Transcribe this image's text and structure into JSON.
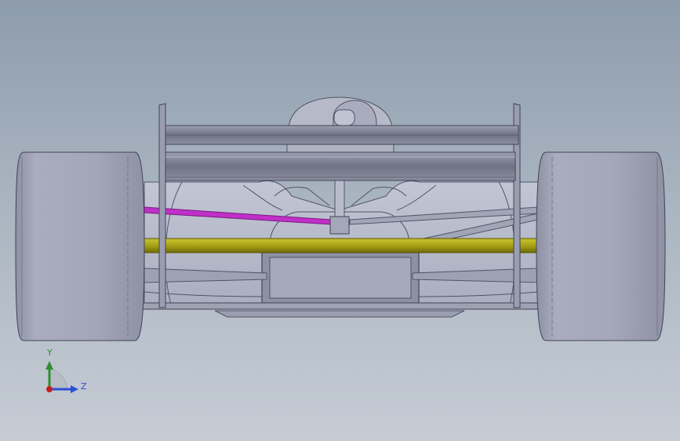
{
  "viewport": {
    "background_top": "#8d9cac",
    "background_bottom": "#c6ccd4"
  },
  "model": {
    "body_color": "#b4b8c8",
    "tire_color": "#a7aabb",
    "highlight_track_rod_color": "#c030c8",
    "highlight_axle_color": "#a5a010"
  },
  "triad": {
    "y_label": "Y",
    "z_label": "Z",
    "y_color": "#2f8f2f",
    "z_color": "#2a4fd6",
    "x_color": "#c42020"
  }
}
